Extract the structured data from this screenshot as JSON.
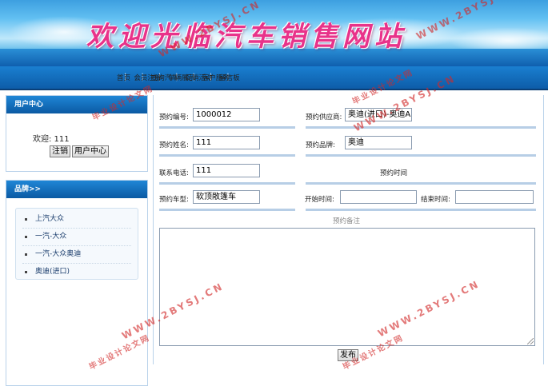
{
  "header": {
    "site_title": "欢迎光临汽车销售网站"
  },
  "nav": {
    "items": [
      "首页",
      "会员注册",
      "查询汽车",
      "车辆展示",
      "促销活动",
      "客户服务",
      "留言板"
    ]
  },
  "sidebar": {
    "user_center": {
      "title": "用户中心",
      "welcome": "欢迎: 111",
      "logout_label": "注销",
      "user_center_label": "用户中心"
    },
    "brands": {
      "title": "品牌>>",
      "items": [
        "上汽大众",
        "一汽-大众",
        "一汽-大众奥迪",
        "奥迪(进口)"
      ]
    }
  },
  "form": {
    "order_no_label": "预约编号:",
    "order_no_value": "1000012",
    "supplier_label": "预约供应商:",
    "supplier_value": "奥迪(进口)-奥迪A",
    "name_label": "预约姓名:",
    "name_value": "111",
    "brand_label": "预约品牌:",
    "brand_value": "奥迪",
    "phone_label": "联系电话:",
    "phone_value": "111",
    "time_label": "预约时间",
    "model_label": "预约车型:",
    "model_value": "软顶敞篷车",
    "start_label": "开始时间:",
    "start_value": "",
    "end_label": "结束时间:",
    "end_value": "",
    "remark_label": "预约备注",
    "remark_value": "",
    "submit_label": "发布"
  },
  "watermark": {
    "url": "WWW.2BYSJ.CN",
    "cn_text": "毕业设计论文网"
  }
}
